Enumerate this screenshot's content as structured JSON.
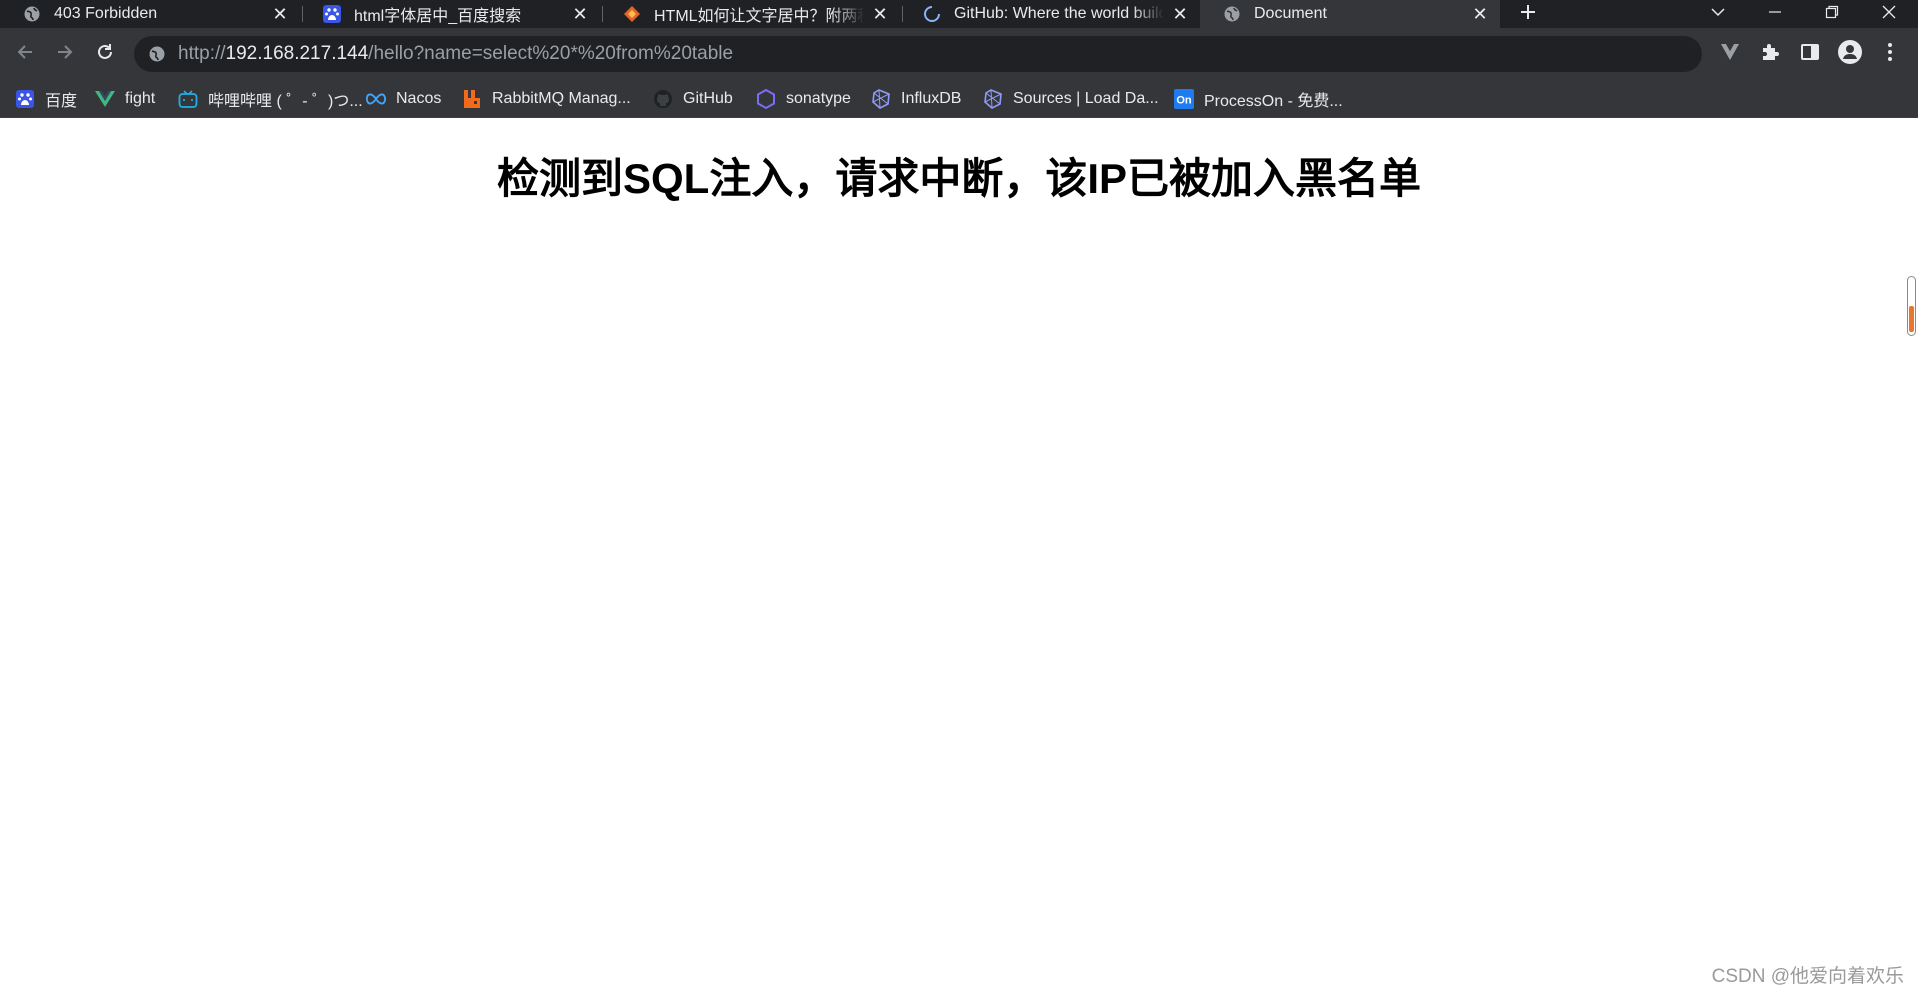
{
  "tabs": [
    {
      "title": "403 Forbidden",
      "icon": "globe-icon",
      "active": false
    },
    {
      "title": "html字体居中_百度搜索",
      "icon": "baidu-icon",
      "active": false
    },
    {
      "title": "HTML如何让文字居中？附两种方法",
      "icon": "sitelogo-icon",
      "active": false
    },
    {
      "title": "GitHub: Where the world builds",
      "icon": "loading-icon",
      "active": false
    },
    {
      "title": "Document",
      "icon": "globe-icon",
      "active": true
    }
  ],
  "address_bar": {
    "scheme": "http://",
    "host": "192.168.217.144",
    "path": "/hello?name=select%20*%20from%20table"
  },
  "bookmarks": [
    {
      "label": "百度",
      "icon": "baidu-icon"
    },
    {
      "label": "fight",
      "icon": "vue-icon"
    },
    {
      "label": "哔哩哔哩 ( ゜- ゜)つ...",
      "icon": "bilibili-icon"
    },
    {
      "label": "Nacos",
      "icon": "nacos-icon"
    },
    {
      "label": "RabbitMQ Manag...",
      "icon": "rabbitmq-icon"
    },
    {
      "label": "GitHub",
      "icon": "github-icon"
    },
    {
      "label": "sonatype",
      "icon": "sonatype-icon"
    },
    {
      "label": "InfluxDB",
      "icon": "influxdb-icon"
    },
    {
      "label": "Sources | Load Da...",
      "icon": "influxdb-icon"
    },
    {
      "label": "ProcessOn - 免费...",
      "icon": "processon-icon"
    }
  ],
  "page": {
    "heading": "检测到SQL注入，请求中断，该IP已被加入黑名单"
  },
  "watermark": "CSDN @他爱向着欢乐",
  "colors": {
    "tabstrip": "#202124",
    "toolbar": "#35363a",
    "omnibox": "#202124",
    "text_light": "#e8eaed",
    "page_bg": "#ffffff"
  }
}
